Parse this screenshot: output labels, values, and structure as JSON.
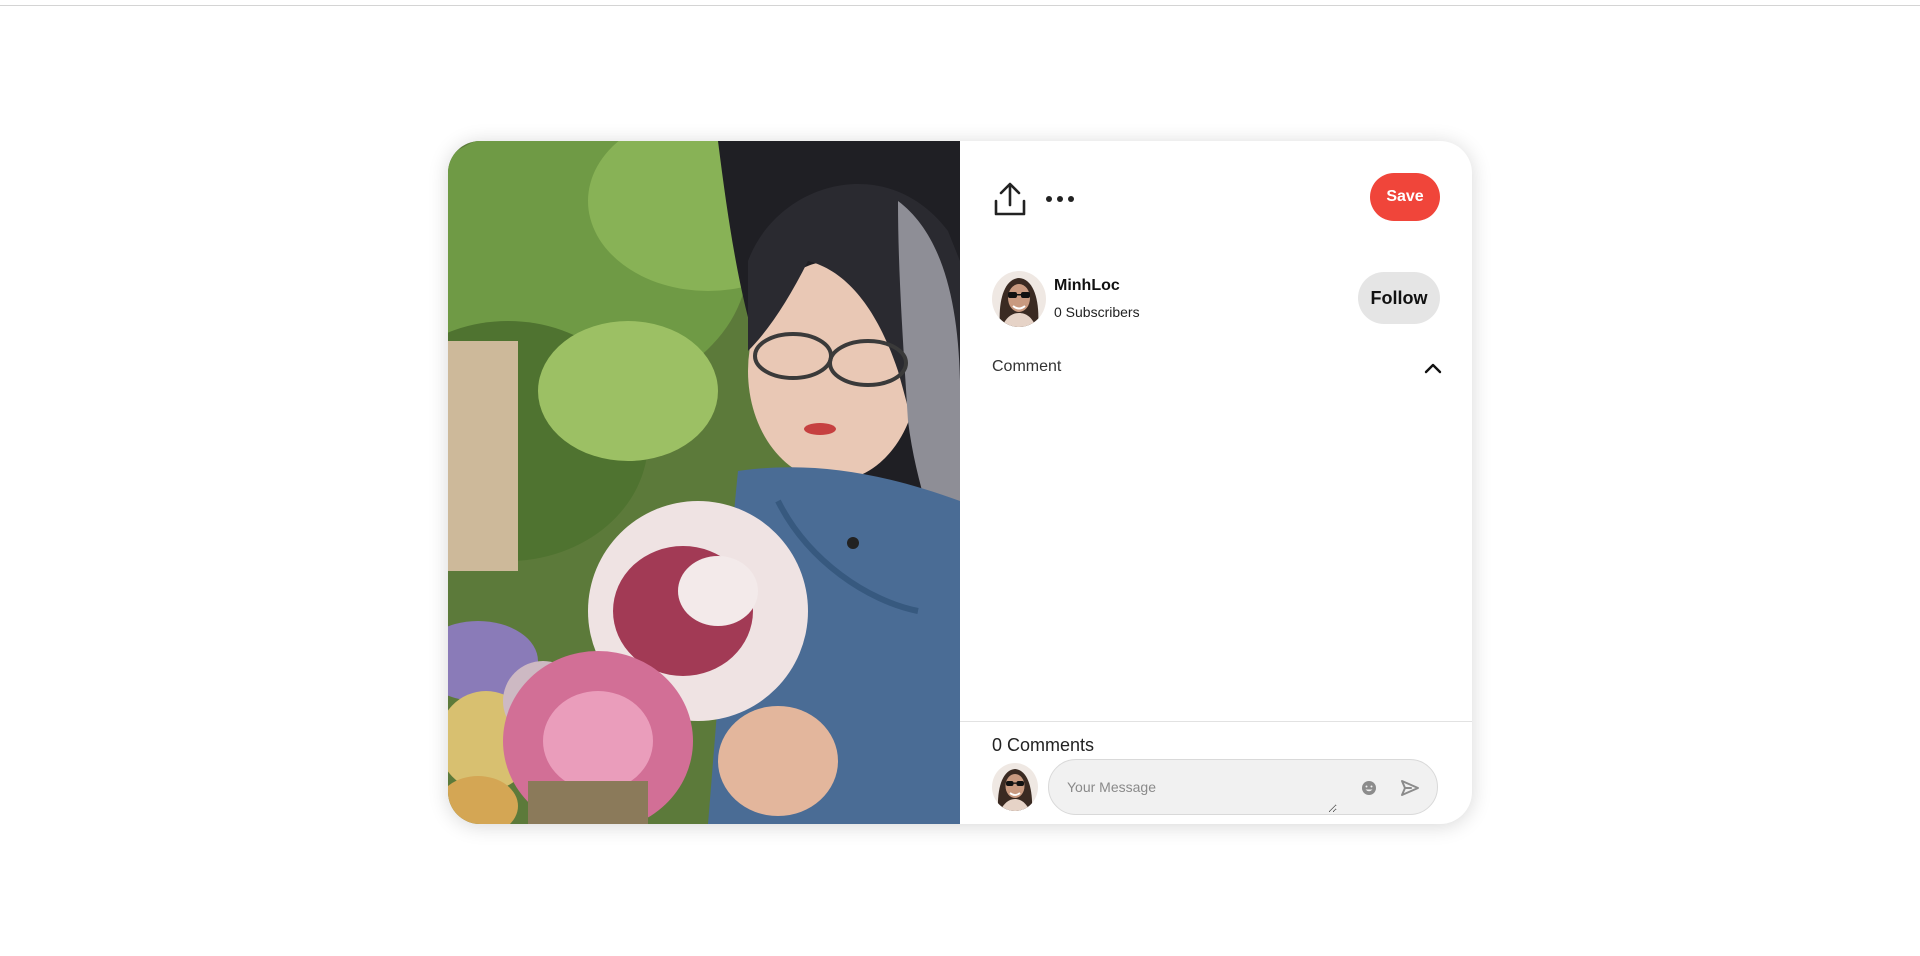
{
  "pin": {
    "image_alt": "Woman with glasses holding flowers",
    "actions": {
      "share_icon": "share-upload-icon",
      "more_icon": "more-dots-icon"
    },
    "save_label": "Save"
  },
  "author": {
    "name": "MinhLoc",
    "subscribers": "0 Subscribers",
    "follow_label": "Follow"
  },
  "comments": {
    "section_label": "Comment",
    "count_label": "0 Comments",
    "input_placeholder": "Your Message",
    "emoji_icon": "emoji-icon",
    "send_icon": "send-icon"
  },
  "colors": {
    "save": "#f0453a",
    "follow": "#e5e5e5",
    "input_bg": "#f1f1f1"
  }
}
